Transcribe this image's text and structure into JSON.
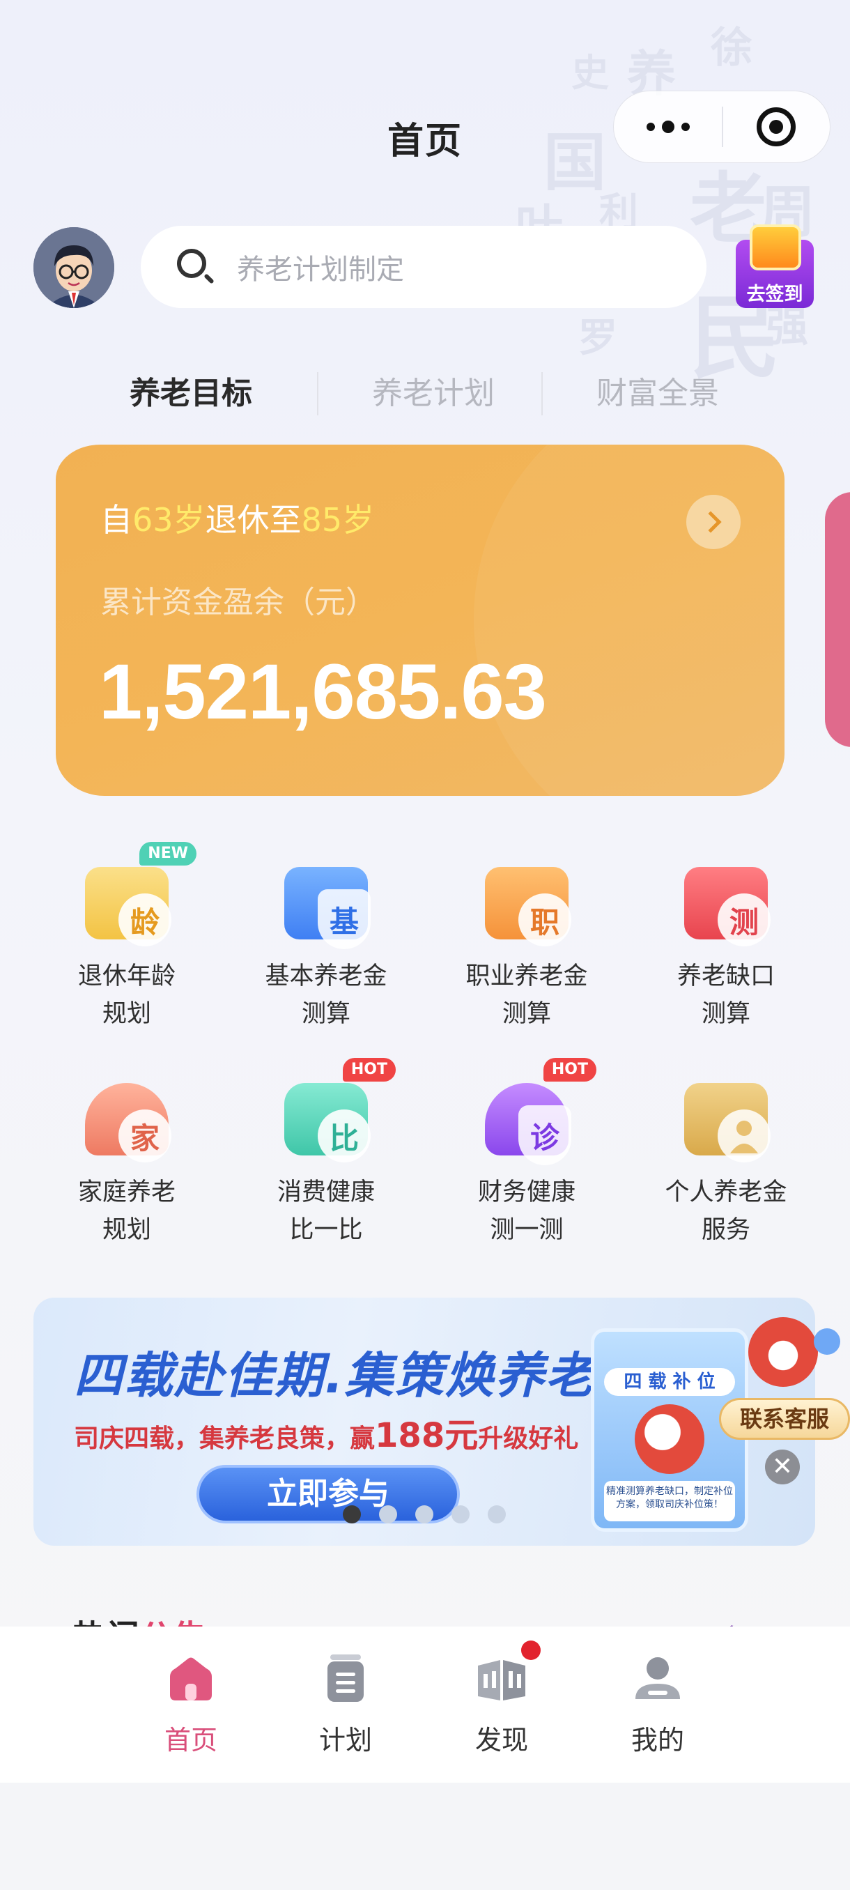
{
  "header": {
    "title": "首页",
    "signin_label": "去签到"
  },
  "search": {
    "placeholder": "养老计划制定"
  },
  "tabs": [
    {
      "label": "养老目标",
      "active": true
    },
    {
      "label": "养老计划",
      "active": false
    },
    {
      "label": "财富全景",
      "active": false
    }
  ],
  "goal_card": {
    "prefix": "自",
    "retire_age": "63岁",
    "middle": "退休至",
    "end_age": "85岁",
    "subtitle": "累计资金盈余（元）",
    "amount": "1,521,685.63"
  },
  "tools": [
    {
      "line1": "退休年龄",
      "line2": "规划",
      "glyph": "龄",
      "badge": "NEW",
      "icon": "retirement-age-icon",
      "color": "#f6c74b"
    },
    {
      "line1": "基本养老金",
      "line2": "测算",
      "glyph": "基",
      "badge": "",
      "icon": "basic-pension-icon",
      "color": "#4b8df6"
    },
    {
      "line1": "职业养老金",
      "line2": "测算",
      "glyph": "职",
      "badge": "",
      "icon": "occupational-pension-icon",
      "color": "#f7a04b"
    },
    {
      "line1": "养老缺口",
      "line2": "测算",
      "glyph": "测",
      "badge": "",
      "icon": "pension-gap-icon",
      "color": "#ef5a62"
    },
    {
      "line1": "家庭养老",
      "line2": "规划",
      "glyph": "家",
      "badge": "",
      "icon": "family-pension-icon",
      "color": "#f0866a"
    },
    {
      "line1": "消费健康",
      "line2": "比一比",
      "glyph": "比",
      "badge": "HOT",
      "icon": "consumption-health-icon",
      "color": "#44cdb0"
    },
    {
      "line1": "财务健康",
      "line2": "测一测",
      "glyph": "诊",
      "badge": "HOT",
      "icon": "financial-health-icon",
      "color": "#9b5cf0"
    },
    {
      "line1": "个人养老金",
      "line2": "服务",
      "glyph": "",
      "badge": "",
      "icon": "personal-pension-icon",
      "color": "#e2b85a"
    }
  ],
  "banner": {
    "title": "四载赴佳期.集策焕养老",
    "sub_prefix": "司庆四载，集养老良策，赢",
    "sub_amount": "188元",
    "sub_suffix": "升级好礼",
    "cta": "立即参与",
    "poster_title": "四 载 补 位",
    "poster_caption": "精准测算养老缺口，制定补位方案，领取司庆补位策！"
  },
  "carousel": {
    "count": 5,
    "active": 0
  },
  "customer_service": {
    "label": "联系客服",
    "close": "✕"
  },
  "hot_notice": {
    "black": "热门",
    "red": "公告",
    "more": "更多 ›"
  },
  "tabbar": [
    {
      "label": "首页",
      "icon": "home-icon",
      "active": true
    },
    {
      "label": "计划",
      "icon": "plan-icon",
      "active": false
    },
    {
      "label": "发现",
      "icon": "discover-icon",
      "active": false,
      "dot": true
    },
    {
      "label": "我的",
      "icon": "profile-icon",
      "active": false
    }
  ],
  "colors": {
    "accent": "#d94e7a",
    "card": "#f2b153",
    "highlight": "#ffea6a"
  }
}
